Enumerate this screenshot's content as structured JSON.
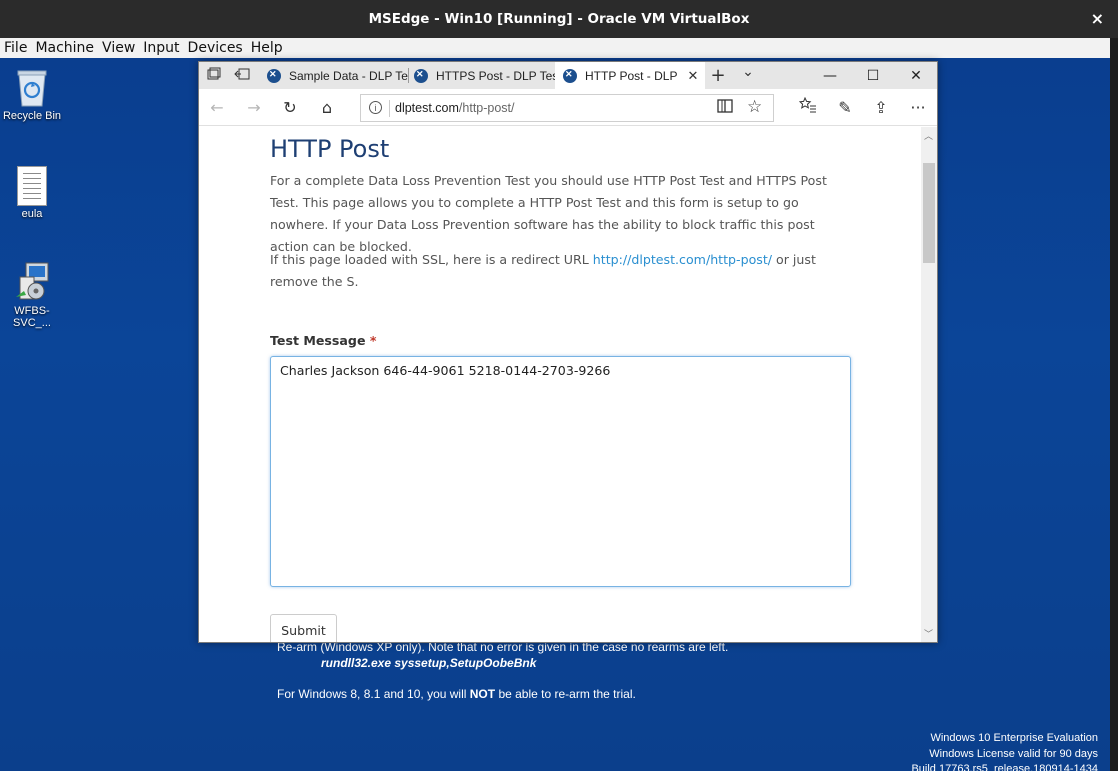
{
  "vbox": {
    "title": "MSEdge - Win10 [Running] - Oracle VM VirtualBox",
    "close_glyph": "×",
    "menu": [
      "File",
      "Machine",
      "View",
      "Input",
      "Devices",
      "Help"
    ]
  },
  "desktop": {
    "icons": [
      {
        "label": "Recycle Bin",
        "icon": "recycle-bin-icon"
      },
      {
        "label": "eula",
        "icon": "text-document-icon"
      },
      {
        "label": "WFBS-SVC_...",
        "icon": "setup-program-icon"
      }
    ],
    "background_text": {
      "line1": "Re-arm (Windows XP only). Note that no error is given in the case no rearms are left.",
      "line2": "rundll32.exe syssetup,SetupOobeBnk",
      "line3_prefix": "For Windows 8, 8.1 and 10, you will ",
      "line3_bold": "NOT",
      "line3_suffix": " be able to re-arm the trial."
    },
    "watermark": {
      "line1": "Windows 10 Enterprise Evaluation",
      "line2": "Windows License valid for 90 days",
      "line3": "Build 17763.rs5_release.180914-1434"
    }
  },
  "browser": {
    "tabs": [
      {
        "label": "Sample Data - DLP Te",
        "active": false
      },
      {
        "label": "HTTPS Post - DLP Tes",
        "active": false
      },
      {
        "label": "HTTP Post - DLP",
        "active": true
      }
    ],
    "new_tab_glyph": "+",
    "tab_list_glyph": "⌄",
    "window_controls": {
      "minimize": "—",
      "maximize": "☐",
      "close": "✕"
    },
    "address": {
      "host": "dlptest.com",
      "path": "/http-post/"
    },
    "nav_glyphs": {
      "back": "←",
      "forward": "→",
      "refresh": "↻",
      "home": "⌂",
      "reading": "📖",
      "favorite": "☆",
      "favorites_hub": "☆≡",
      "notes": "✎",
      "share": "⇪",
      "more": "···"
    }
  },
  "page": {
    "title": "HTTP Post",
    "intro": "For a complete Data Loss Prevention Test you should use HTTP Post Test and HTTPS Post Test. This page allows you to complete a HTTP Post Test and this form is setup to go nowhere. If your Data Loss Prevention software has the ability to block traffic this post action can be blocked.",
    "ssl_prefix": "If this page loaded with SSL, here is a redirect URL ",
    "ssl_link": "http://dlptest.com/http-post/",
    "ssl_suffix": " or just remove the S.",
    "field_label": "Test Message",
    "required_mark": "*",
    "message_value": "Charles Jackson 646-44-9061 5218-0144-2703-9266",
    "submit_label": "Submit"
  },
  "colors": {
    "desktop": "#0b4598",
    "heading": "#1e3f73",
    "link": "#2a8fd0",
    "focus_border": "#78b3e3"
  }
}
